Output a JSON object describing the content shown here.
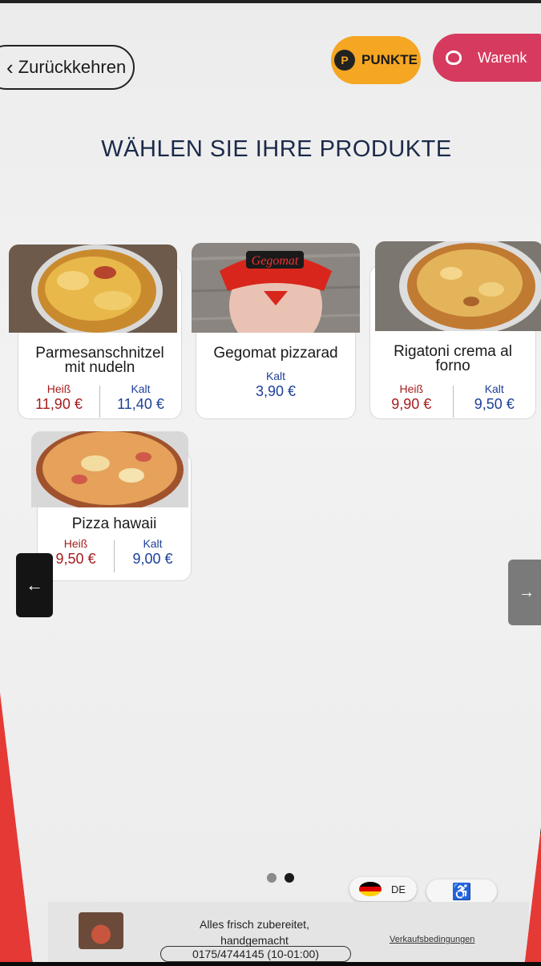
{
  "header": {
    "back_label": "Zurückkehren",
    "points_icon_letter": "P",
    "points_label": "PUNKTE",
    "cart_label": "Warenk"
  },
  "title": "WÄHLEN SIE IHRE PRODUKTE",
  "products": [
    {
      "name_line1": "Parmesanschnitzel",
      "name_line2": "mit nudeln",
      "hot_label": "Heiß",
      "hot_price": "11,90 €",
      "cold_label": "Kalt",
      "cold_price": "11,40 €"
    },
    {
      "name_line1": "Gegomat pizzarad",
      "cold_label": "Kalt",
      "cold_price": "3,90 €",
      "logo_text": "Gegomat"
    },
    {
      "name_line1": "Rigatoni crema al",
      "name_line2": "forno",
      "hot_label": "Heiß",
      "hot_price": "9,90 €",
      "cold_label": "Kalt",
      "cold_price": "9,50 €"
    },
    {
      "name_line1": "Pizza hawaii",
      "hot_label": "Heiß",
      "hot_price": "9,50 €",
      "cold_label": "Kalt",
      "cold_price": "9,00 €"
    }
  ],
  "nav": {
    "prev_icon": "←",
    "next_icon": "→"
  },
  "pagination": {
    "pages": 2,
    "active": 2
  },
  "language": {
    "code": "DE",
    "flag": "german-flag"
  },
  "accessibility_icon": "♿",
  "footer": {
    "tagline_line1": "Alles frisch zubereitet,",
    "tagline_line2": "handgemacht",
    "phone": "0175/4744145 (10-01:00)",
    "terms": "Verkaufsbedingungen"
  },
  "colors": {
    "points": "#f5a623",
    "cart": "#d63a5e",
    "hot_price": "#a61c1c",
    "cold_price": "#1d3f9a",
    "title": "#1b2a4a"
  }
}
